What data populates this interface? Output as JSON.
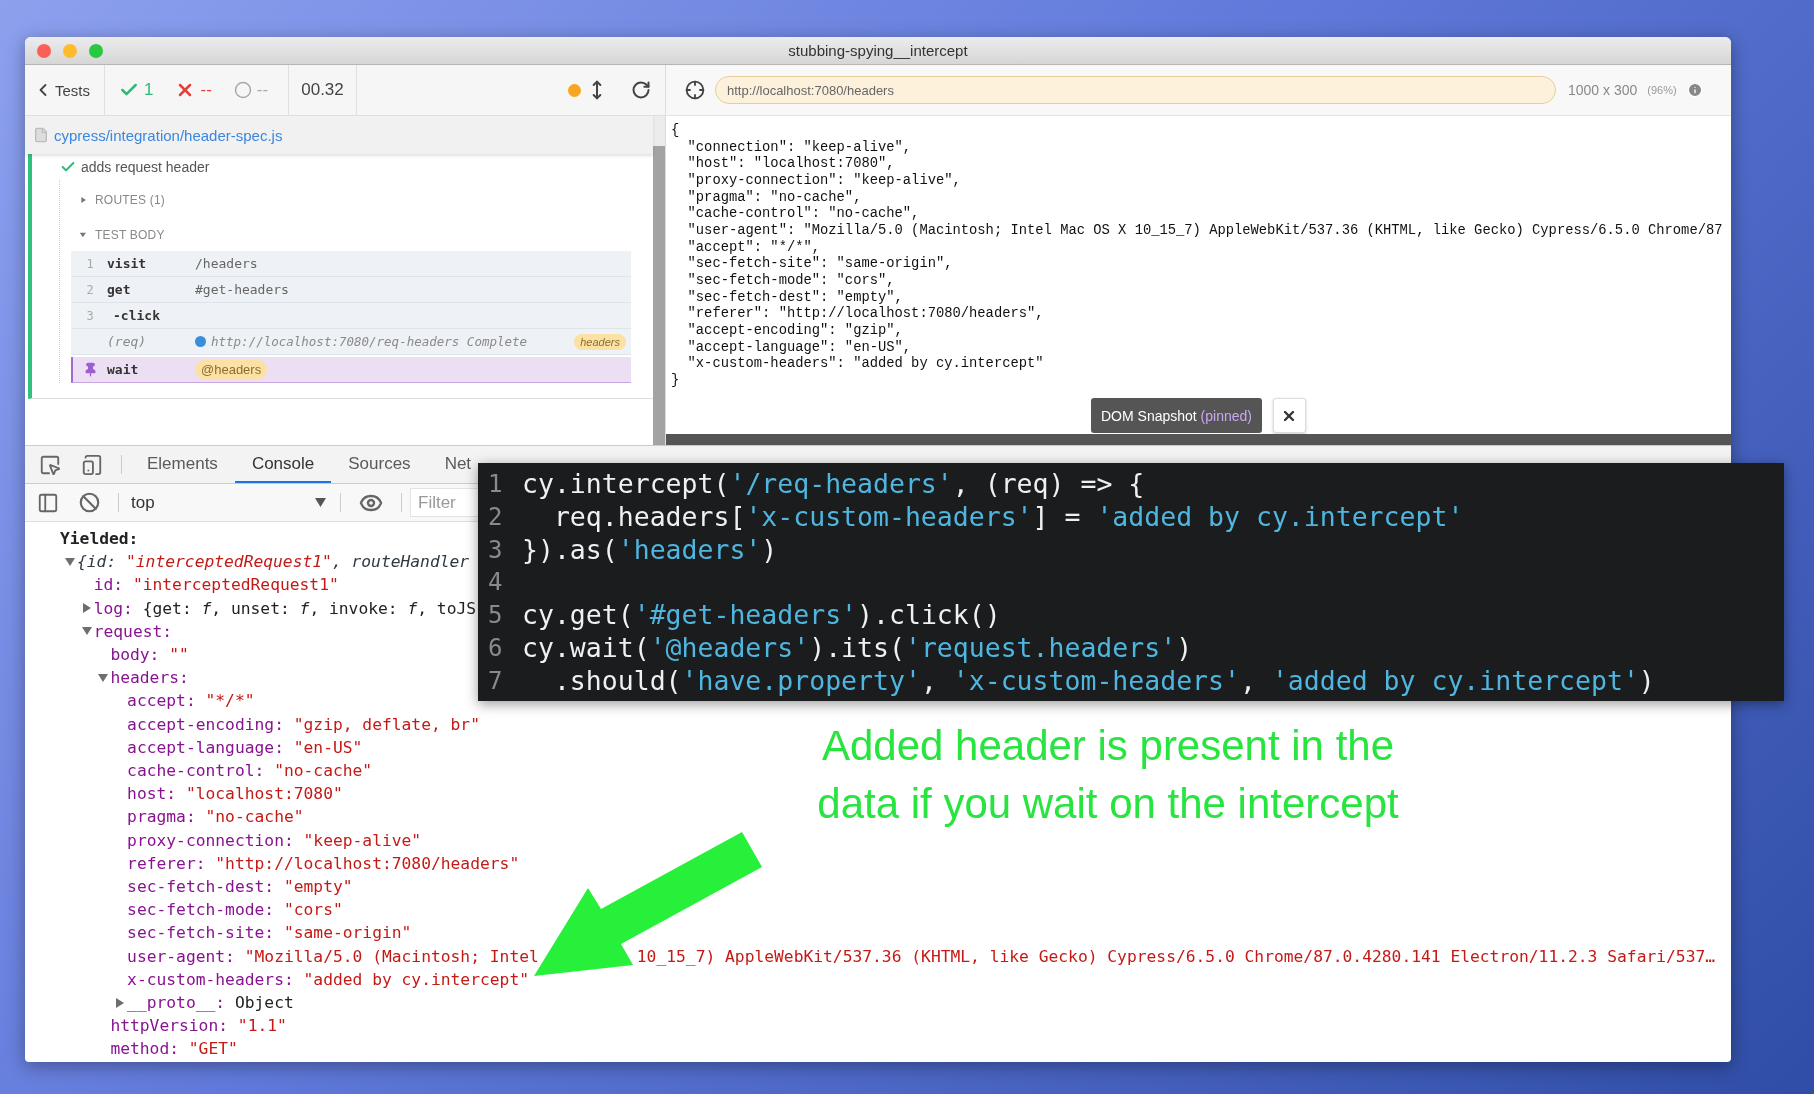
{
  "window": {
    "title": "stubbing-spying__intercept"
  },
  "runner": {
    "toolbar": {
      "back": "Tests",
      "passed": "1",
      "failed": "--",
      "pending": "--",
      "duration": "00.32"
    },
    "spec": "cypress/integration/header-spec.js",
    "test": {
      "title": "adds request header",
      "passed": true,
      "sections": [
        {
          "label": "ROUTES (1)",
          "expanded": false
        },
        {
          "label": "TEST BODY",
          "expanded": true,
          "commands": [
            {
              "kind": "command",
              "number": "1",
              "name": "visit",
              "message": "/headers",
              "pinned": false
            },
            {
              "kind": "command",
              "number": "2",
              "name": "get",
              "message": "#get-headers",
              "pinned": false
            },
            {
              "kind": "child",
              "number": "3",
              "name": "-click",
              "pinned": false
            },
            {
              "kind": "request",
              "name": "(req)",
              "message": "http://localhost:7080/req-headers Complete",
              "badge": "headers",
              "pinned": false
            },
            {
              "kind": "command",
              "name": "wait",
              "badge": "@headers",
              "pinned": true
            }
          ]
        }
      ]
    }
  },
  "aut": {
    "url": "http://localhost:7080/headers",
    "viewport": "1000 x 300",
    "scale": "(96%)",
    "body_lines": [
      "{",
      "  \"connection\": \"keep-alive\",",
      "  \"host\": \"localhost:7080\",",
      "  \"proxy-connection\": \"keep-alive\",",
      "  \"pragma\": \"no-cache\",",
      "  \"cache-control\": \"no-cache\",",
      "  \"user-agent\": \"Mozilla/5.0 (Macintosh; Intel Mac OS X 10_15_7) AppleWebKit/537.36 (KHTML, like Gecko) Cypress/6.5.0 Chrome/87",
      "  \"accept\": \"*/*\",",
      "  \"sec-fetch-site\": \"same-origin\",",
      "  \"sec-fetch-mode\": \"cors\",",
      "  \"sec-fetch-dest\": \"empty\",",
      "  \"referer\": \"http://localhost:7080/headers\",",
      "  \"accept-encoding\": \"gzip\",",
      "  \"accept-language\": \"en-US\",",
      "  \"x-custom-headers\": \"added by cy.intercept\"",
      "}"
    ],
    "snapshot": {
      "label": "DOM Snapshot",
      "note": "(pinned)"
    }
  },
  "devtools": {
    "tabs": [
      {
        "label": "Elements",
        "selected": false
      },
      {
        "label": "Console",
        "selected": true
      },
      {
        "label": "Sources",
        "selected": false
      },
      {
        "label": "Net",
        "selected": false
      }
    ],
    "context": "top",
    "filter_placeholder": "Filter",
    "console": {
      "heading": "Yielded:",
      "tree": [
        {
          "kind": "preview",
          "expanded": true,
          "parts": [
            {
              "text": "{id: ",
              "kind": "plain"
            },
            {
              "text": "\"interceptedRequest1\"",
              "kind": "string"
            },
            {
              "text": ", routeHandler",
              "kind": "plain"
            }
          ],
          "children": [
            {
              "key": "id:",
              "value": "\"interceptedRequest1\"",
              "kind": "string"
            },
            {
              "key": "log:",
              "value": "{get: *f*, unset: *f*, invoke: *f*, toJS",
              "kind": "object",
              "expanded": false
            },
            {
              "key": "request:",
              "kind": "group",
              "expanded": true,
              "children": [
                {
                  "key": "body:",
                  "value": "\"\"",
                  "kind": "string"
                },
                {
                  "key": "headers:",
                  "kind": "group",
                  "expanded": true,
                  "children": [
                    {
                      "key": "accept:",
                      "value": "\"*/*\"",
                      "kind": "string"
                    },
                    {
                      "key": "accept-encoding:",
                      "value": "\"gzip, deflate, br\"",
                      "kind": "string"
                    },
                    {
                      "key": "accept-language:",
                      "value": "\"en-US\"",
                      "kind": "string"
                    },
                    {
                      "key": "cache-control:",
                      "value": "\"no-cache\"",
                      "kind": "string"
                    },
                    {
                      "key": "host:",
                      "value": "\"localhost:7080\"",
                      "kind": "string"
                    },
                    {
                      "key": "pragma:",
                      "value": "\"no-cache\"",
                      "kind": "string"
                    },
                    {
                      "key": "proxy-connection:",
                      "value": "\"keep-alive\"",
                      "kind": "string"
                    },
                    {
                      "key": "referer:",
                      "value": "\"http://localhost:7080/headers\"",
                      "kind": "string"
                    },
                    {
                      "key": "sec-fetch-dest:",
                      "value": "\"empty\"",
                      "kind": "string"
                    },
                    {
                      "key": "sec-fetch-mode:",
                      "value": "\"cors\"",
                      "kind": "string"
                    },
                    {
                      "key": "sec-fetch-site:",
                      "value": "\"same-origin\"",
                      "kind": "string"
                    },
                    {
                      "key": "user-agent:",
                      "value_parts": [
                        "\"Mozilla/5.0 (Macintosh; Intel",
                        "10_15_7) AppleWebKit/537.36 (KHTML, like Gecko) Cypress/6.5.0 Chrome/87.0.4280.141 Electron/11.2.3 Safari/537…"
                      ],
                      "kind": "string"
                    },
                    {
                      "key": "x-custom-headers:",
                      "value": "\"added by cy.intercept\"",
                      "kind": "string"
                    },
                    {
                      "key": "__proto__:",
                      "value": "Object",
                      "kind": "object",
                      "expanded": false
                    }
                  ]
                },
                {
                  "key": "httpVersion:",
                  "value": "\"1.1\"",
                  "kind": "string"
                },
                {
                  "key": "method:",
                  "value": "\"GET\"",
                  "kind": "string"
                }
              ]
            }
          ]
        }
      ]
    }
  },
  "code_overlay": {
    "lines": [
      {
        "number": "1",
        "segments": [
          {
            "text": "cy.intercept(",
            "kind": "code"
          },
          {
            "text": "'/req-headers'",
            "kind": "string"
          },
          {
            "text": ", (req) => {",
            "kind": "code"
          }
        ]
      },
      {
        "number": "2",
        "segments": [
          {
            "text": "  req.headers[",
            "kind": "code"
          },
          {
            "text": "'x-custom-headers'",
            "kind": "string"
          },
          {
            "text": "] = ",
            "kind": "code"
          },
          {
            "text": "'added by cy.intercept'",
            "kind": "string"
          }
        ]
      },
      {
        "number": "3",
        "segments": [
          {
            "text": "}).as(",
            "kind": "code"
          },
          {
            "text": "'headers'",
            "kind": "string"
          },
          {
            "text": ")",
            "kind": "code"
          }
        ]
      },
      {
        "number": "4"
      },
      {
        "number": "5",
        "segments": [
          {
            "text": "cy.get(",
            "kind": "code"
          },
          {
            "text": "'#get-headers'",
            "kind": "string"
          },
          {
            "text": ").click()",
            "kind": "code"
          }
        ]
      },
      {
        "number": "6",
        "segments": [
          {
            "text": "cy.wait(",
            "kind": "code"
          },
          {
            "text": "'@headers'",
            "kind": "string"
          },
          {
            "text": ").its(",
            "kind": "code"
          },
          {
            "text": "'request.headers'",
            "kind": "string"
          },
          {
            "text": ")",
            "kind": "code"
          }
        ]
      },
      {
        "number": "7",
        "segments": [
          {
            "text": "  .should(",
            "kind": "code"
          },
          {
            "text": "'have.property'",
            "kind": "string"
          },
          {
            "text": ", ",
            "kind": "code"
          },
          {
            "text": "'x-custom-headers'",
            "kind": "string"
          },
          {
            "text": ", ",
            "kind": "code"
          },
          {
            "text": "'added by cy.intercept'",
            "kind": "string"
          },
          {
            "text": ")",
            "kind": "code"
          }
        ]
      }
    ]
  },
  "annotation": {
    "lines": [
      "Added header is present in the",
      "data if you wait on the intercept"
    ]
  }
}
